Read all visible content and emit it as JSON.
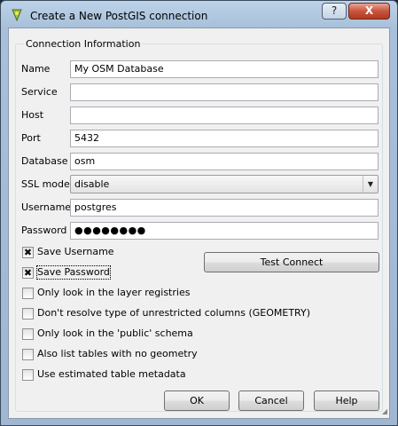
{
  "window": {
    "title": "Create a New PostGIS connection",
    "help_button": "?",
    "close_button": "X"
  },
  "group": {
    "title": "Connection Information"
  },
  "fields": {
    "name": {
      "label": "Name",
      "value": "My OSM Database"
    },
    "service": {
      "label": "Service",
      "value": ""
    },
    "host": {
      "label": "Host",
      "value": ""
    },
    "port": {
      "label": "Port",
      "value": "5432"
    },
    "database": {
      "label": "Database",
      "value": "osm"
    },
    "ssl_mode": {
      "label": "SSL mode",
      "value": "disable"
    },
    "username": {
      "label": "Username",
      "value": "postgres"
    },
    "password": {
      "label": "Password",
      "value": "●●●●●●●●"
    }
  },
  "checkboxes": {
    "save_username": {
      "label": "Save Username",
      "checked": true,
      "mark": "✖"
    },
    "save_password": {
      "label": "Save Password",
      "checked": true,
      "mark": "✖"
    },
    "layer_registries": {
      "label": "Only look in the layer registries",
      "checked": false,
      "mark": ""
    },
    "dont_resolve": {
      "label": "Don't resolve type of unrestricted columns (GEOMETRY)",
      "checked": false,
      "mark": ""
    },
    "public_schema": {
      "label": "Only look in the 'public' schema",
      "checked": false,
      "mark": ""
    },
    "no_geometry": {
      "label": "Also list tables with no geometry",
      "checked": false,
      "mark": ""
    },
    "estimated_metadata": {
      "label": "Use estimated table metadata",
      "checked": false,
      "mark": ""
    }
  },
  "buttons": {
    "test_connect": "Test Connect",
    "ok": "OK",
    "cancel": "Cancel",
    "help": "Help"
  },
  "icons": {
    "app_icon": "qgis-logo-icon",
    "dropdown_arrow": "chevron-down-icon",
    "resize_grip": "resize-grip-icon"
  }
}
